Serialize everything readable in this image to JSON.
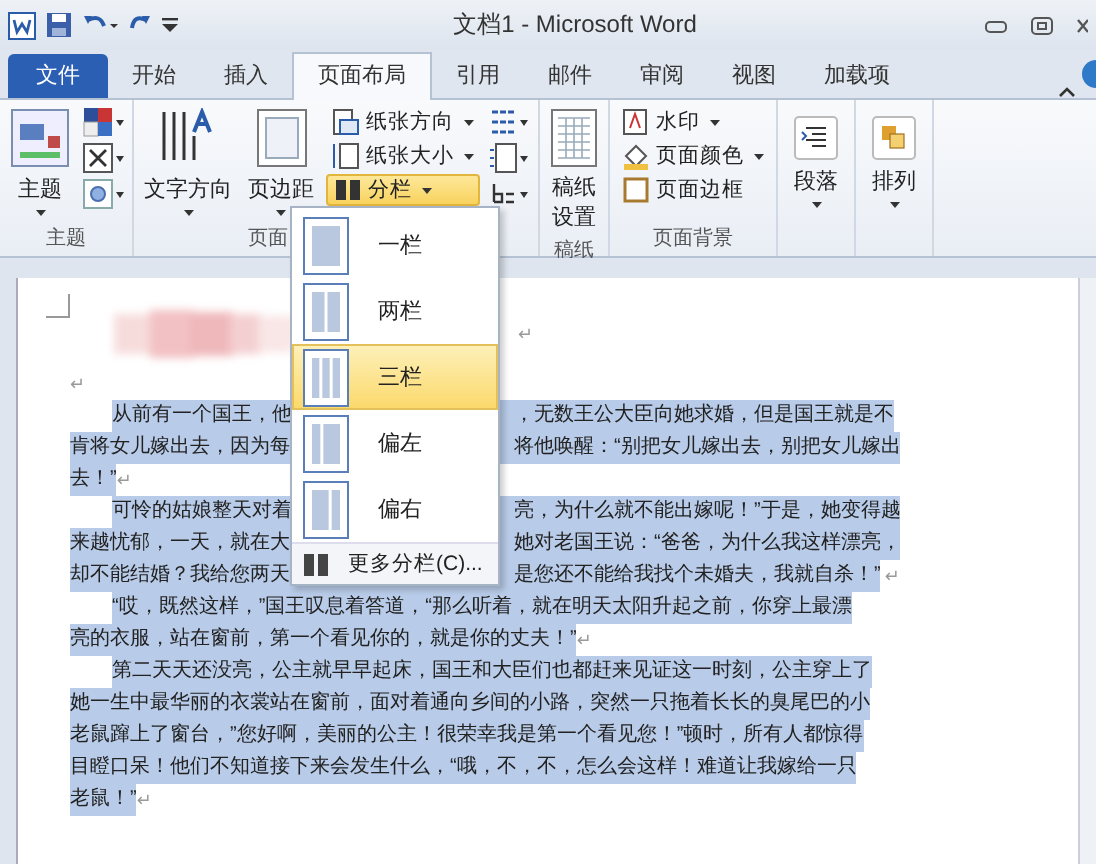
{
  "window": {
    "title": "文档1 - Microsoft Word"
  },
  "tabs": [
    {
      "label": "文件",
      "kind": "file",
      "selected": false
    },
    {
      "label": "开始",
      "kind": "tab",
      "selected": false
    },
    {
      "label": "插入",
      "kind": "tab",
      "selected": false
    },
    {
      "label": "页面布局",
      "kind": "tab",
      "selected": true
    },
    {
      "label": "引用",
      "kind": "tab",
      "selected": false
    },
    {
      "label": "邮件",
      "kind": "tab",
      "selected": false
    },
    {
      "label": "审阅",
      "kind": "tab",
      "selected": false
    },
    {
      "label": "视图",
      "kind": "tab",
      "selected": false
    },
    {
      "label": "加载项",
      "kind": "tab",
      "selected": false
    }
  ],
  "ribbon": {
    "theme": {
      "label": "主题",
      "button": "主题"
    },
    "page_setup": {
      "label": "页面",
      "text_direction": "文字方向",
      "margins": "页边距",
      "orientation": "纸张方向",
      "size": "纸张大小",
      "columns": {
        "label": "分栏",
        "selected": true
      }
    },
    "manuscript": {
      "label": "稿纸",
      "button": "稿纸设置"
    },
    "background": {
      "label": "页面背景",
      "watermark": "水印",
      "page_color": "页面颜色",
      "page_border": "页面边框"
    },
    "paragraph": "段落",
    "arrange": "排列"
  },
  "columns_menu": {
    "items": [
      {
        "label": "一栏",
        "kind": "one",
        "selected": false
      },
      {
        "label": "两栏",
        "kind": "two",
        "selected": false
      },
      {
        "label": "三栏",
        "kind": "three",
        "selected": true
      },
      {
        "label": "偏左",
        "kind": "left",
        "selected": false
      },
      {
        "label": "偏右",
        "kind": "right",
        "selected": false
      }
    ],
    "more": "更多分栏(C)..."
  },
  "document": {
    "selected": true,
    "blank_mark": "↵",
    "title_mark": "↵",
    "paragraphs": [
      {
        "end": "↵",
        "lines": [
          {
            "left": "从前有一个国王，他",
            "right": "，无数王公大臣向她求婚，但是国王就是不"
          },
          {
            "left": "肯将女儿嫁出去，因为每",
            "right": "将他唤醒：“别把女儿嫁出去，别把女儿嫁出"
          },
          {
            "left": "去！”"
          }
        ]
      },
      {
        "end": "↵",
        "lines": [
          {
            "left": "可怜的姑娘整天对着",
            "right": "亮，为什么就不能出嫁呢！”于是，她变得越"
          },
          {
            "left": "来越忧郁，一天，就在大",
            "right": "她对老国王说：“爸爸，为什么我这样漂亮，"
          },
          {
            "left": "却不能结婚？我给您两天",
            "right": "是您还不能给我找个未婚夫，我就自杀！”"
          }
        ]
      },
      {
        "end": "↵",
        "lines": [
          {
            "left": "“哎，既然这样，”国王叹息着答道，“那么听着，就在明天太阳升起之前，你穿上最漂"
          },
          {
            "left": "亮的衣服，站在窗前，第一个看见你的，就是你的丈夫！”"
          }
        ]
      },
      {
        "end": "↵",
        "lines": [
          {
            "left": "第二天天还没亮，公主就早早起床，国王和大臣们也都赶来见证这一时刻，公主穿上了"
          },
          {
            "left": "她一生中最华丽的衣裳站在窗前，面对着通向乡间的小路，突然一只拖着长长的臭尾巴的小"
          },
          {
            "left": "老鼠蹿上了窗台，”您好啊，美丽的公主！很荣幸我是第一个看见您！”顿时，所有人都惊得"
          },
          {
            "left": "目瞪口呆！他们不知道接下来会发生什么，“哦，不，不，怎么会这样！难道让我嫁给一只"
          },
          {
            "left": "老鼠！”"
          }
        ]
      }
    ]
  }
}
